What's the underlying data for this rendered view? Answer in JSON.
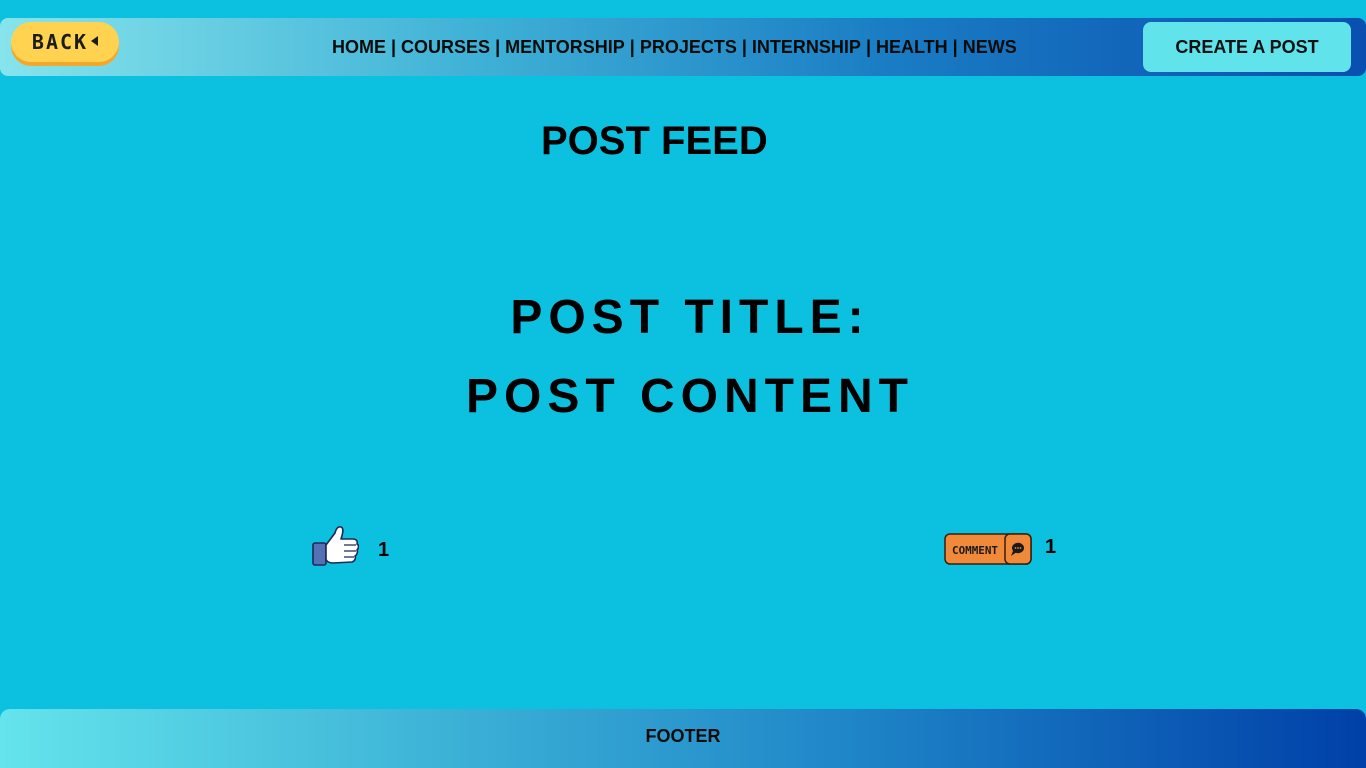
{
  "header": {
    "back_label": "BACK",
    "nav": [
      "HOME",
      "COURSES",
      "MENTORSHIP",
      "PROJECTS",
      "INTERNSHIP",
      "HEALTH",
      "NEWS"
    ],
    "nav_separator": "|",
    "create_label": "CREATE A POST"
  },
  "main": {
    "feed_title": "POST FEED",
    "post": {
      "title_label": "POST TITLE:",
      "content_label": "POST CONTENT",
      "like_count": "1",
      "comment_count": "1",
      "comment_button_label": "COMMENT"
    }
  },
  "footer": {
    "label": "FOOTER"
  },
  "icons": {
    "back": "chevron-left-icon",
    "like": "thumbs-up-icon",
    "comment": "speech-bubble-icon"
  },
  "colors": {
    "background": "#0cc0e0",
    "back_button": "#ffd34f",
    "create_button": "#61e3ec",
    "comment_button": "#f08a3a",
    "footer_end": "#0040a8"
  }
}
